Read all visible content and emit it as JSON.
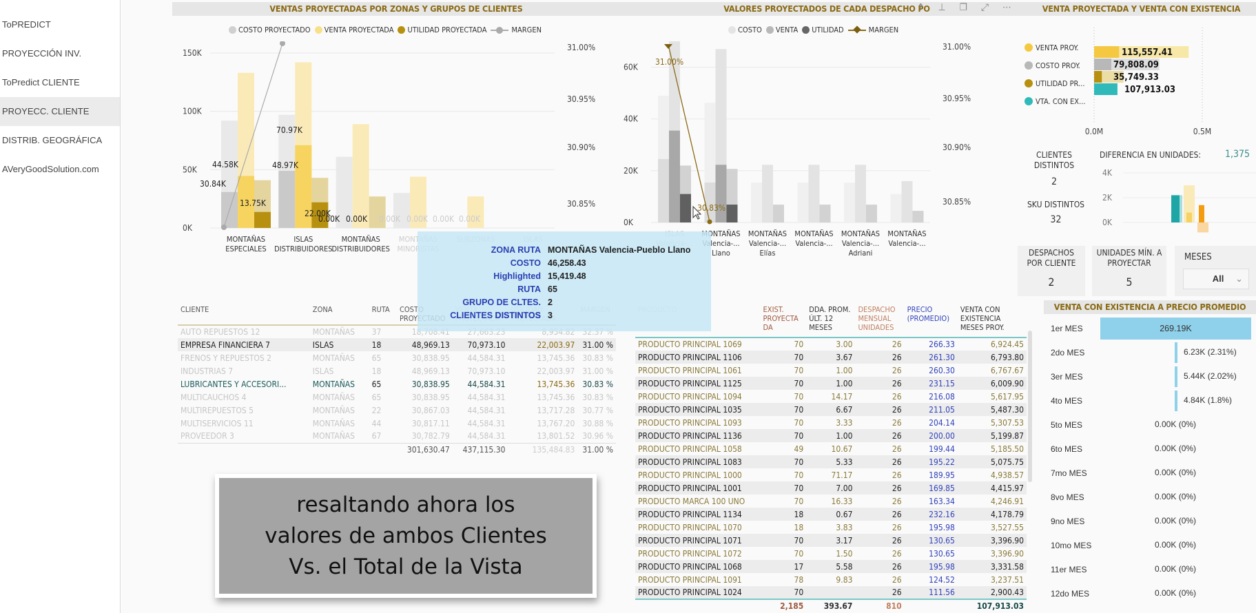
{
  "sidebar": {
    "items": [
      {
        "label": "ToPREDICT",
        "active": false
      },
      {
        "label": "PROYECCIÓN INV.",
        "active": false
      },
      {
        "label": "ToPredict CLIENTE",
        "active": false
      },
      {
        "label": "PROYECC. CLIENTE",
        "active": true
      },
      {
        "label": "DISTRIB. GEOGRÁFICA",
        "active": false
      },
      {
        "label": "AVeryGoodSolution.com",
        "active": false
      }
    ]
  },
  "chart1": {
    "title": "VENTAS PROYECTADAS POR ZONAS Y GRUPOS DE CLIENTES",
    "legend": [
      "COSTO PROYECTADO",
      "VENTA PROYECTADA",
      "UTILIDAD PROYECTADA",
      "MARGEN"
    ],
    "y_ticks": [
      "150K",
      "100K",
      "50K",
      "0K"
    ],
    "y2_ticks": [
      "31.00%",
      "30.95%",
      "30.90%",
      "30.85%"
    ],
    "categories": [
      "MONTAÑAS|ESPECIALES",
      "ISLAS|DISTRIBUIDORES",
      "MONTAÑAS|DISTRIBUIDORES",
      "MONTAÑAS|MINORISTAS",
      "SUBZONAS",
      "ISLAS"
    ],
    "data_labels": [
      "30.84K",
      "44.58K",
      "13.75K",
      "48.97K",
      "70.97K",
      "22.00K",
      "0.00K",
      "0.00K",
      "0.00K",
      "0.00K",
      "0.00K",
      "0.00K"
    ]
  },
  "chart2": {
    "title": "VALORES PROYECTADOS DE CADA DESPACHO PO",
    "legend": [
      "COSTO",
      "VENTA",
      "UTILIDAD",
      "MARGEN"
    ],
    "y_ticks": [
      "60K",
      "40K",
      "20K",
      "0K"
    ],
    "y2_ticks": [
      "31.00%",
      "30.95%",
      "30.90%",
      "30.85%"
    ],
    "categories": [
      "ISLAS|Valencia-...",
      "MONTAÑAS|Valencia-...|Llano",
      "MONTAÑAS|Valencia-...|Elías",
      "MONTAÑAS|Valencia-...",
      "MONTAÑAS|Valencia-...|Adriani",
      "MONTAÑAS|Valencia-..."
    ],
    "margin_labels": [
      "31.00%",
      "30.83%"
    ]
  },
  "chart_data": [
    {
      "type": "bar",
      "title": "VENTAS PROYECTADAS POR ZONAS Y GRUPOS DE CLIENTES",
      "categories": [
        "MONTAÑAS ESPECIALES",
        "ISLAS DISTRIBUIDORES",
        "MONTAÑAS DISTRIBUIDORES",
        "MONTAÑAS MINORISTAS",
        "SUBZONAS",
        "ISLAS"
      ],
      "series": [
        {
          "name": "COSTO PROYECTADO",
          "values": [
            92000,
            97000,
            61000,
            30000,
            0,
            0
          ],
          "highlighted": [
            30840,
            48970,
            0,
            0,
            0,
            0
          ]
        },
        {
          "name": "VENTA PROYECTADA",
          "values": [
            133000,
            142000,
            89000,
            44000,
            27000,
            0
          ],
          "highlighted": [
            44580,
            70970,
            0,
            0,
            0,
            0
          ]
        },
        {
          "name": "UTILIDAD PROYECTADA",
          "values": [
            41000,
            43000,
            27000,
            0,
            0,
            0
          ],
          "highlighted": [
            13750,
            22000,
            0,
            0,
            0,
            0
          ]
        },
        {
          "name": "MARGEN",
          "values": [
            30.83,
            31.0
          ],
          "axis": "right"
        }
      ],
      "ylim": [
        0,
        160000
      ],
      "y2lim": [
        30.82,
        31.01
      ]
    },
    {
      "type": "bar",
      "title": "VALORES PROYECTADOS DE CADA DESPACHO PO",
      "categories": [
        "ISLAS Valencia-...",
        "MONTAÑAS Valencia-... Llano",
        "MONTAÑAS Valencia-... Elías",
        "MONTAÑAS Valencia-...",
        "MONTAÑAS Valencia-... Adriani",
        "MONTAÑAS Valencia-..."
      ],
      "series": [
        {
          "name": "COSTO",
          "values": [
            49000,
            46258,
            15400,
            15400,
            15400,
            11000
          ],
          "highlighted": [
            24500,
            15419,
            0,
            0,
            0,
            0
          ]
        },
        {
          "name": "VENTA",
          "values": [
            71000,
            67000,
            22300,
            22300,
            22300,
            16000
          ],
          "highlighted": [
            35500,
            22300,
            0,
            0,
            0,
            0
          ]
        },
        {
          "name": "UTILIDAD",
          "values": [
            22000,
            20700,
            6900,
            6900,
            6900,
            4500
          ],
          "highlighted": [
            11000,
            6900,
            0,
            0,
            0,
            0
          ]
        },
        {
          "name": "MARGEN",
          "values": [
            31.0,
            30.83
          ],
          "axis": "right"
        }
      ],
      "ylim": [
        0,
        70000
      ],
      "y2lim": [
        30.82,
        31.01
      ]
    },
    {
      "type": "bar",
      "title": "VENTA PROYECTADA Y VENTA CON EXISTENCIA",
      "categories": [
        "VENTA PROY.",
        "COSTO PROY.",
        "UTILIDAD PR...",
        "VTA. CON EX..."
      ],
      "values": [
        115557.41,
        79808.09,
        35749.33,
        107913.03
      ],
      "totals": [
        437115.3,
        301630.47,
        135484.83,
        107913.03
      ],
      "xlim": [
        0,
        0.5
      ],
      "xticks": [
        "0.0M",
        "0.5M"
      ]
    },
    {
      "type": "bar",
      "title": "DIFERENCIA EN UNIDADES",
      "yticks": [
        "4K",
        "2K",
        "0K"
      ],
      "values": [
        2200,
        3000,
        800,
        1400,
        -800
      ]
    },
    {
      "type": "bar",
      "title": "VENTA CON EXISTENCIA A PRECIO PROMEDIO",
      "categories": [
        "1er MES",
        "2do MES",
        "3er MES",
        "4to MES",
        "5to MES",
        "6to MES",
        "7mo MES",
        "8vo MES",
        "9no MES",
        "10mo MES",
        "11er MES",
        "12do MES"
      ],
      "values": [
        269.19,
        6.23,
        5.44,
        4.84,
        0,
        0,
        0,
        0,
        0,
        0,
        0,
        0
      ],
      "labels": [
        "269.19K",
        "6.23K (2.31%)",
        "5.44K (2.02%)",
        "4.84K (1.8%)",
        "0.00K (0%)",
        "0.00K (0%)",
        "0.00K (0%)",
        "0.00K (0%)",
        "0.00K (0%)",
        "0.00K (0%)",
        "0.00K (0%)",
        "0.00K (0%)"
      ]
    }
  ],
  "tooltip": {
    "rows": [
      {
        "k": "ZONA RUTA",
        "v": "MONTAÑAS Valencia-Pueblo Llano"
      },
      {
        "k": "COSTO",
        "v": "46,258.43"
      },
      {
        "k": "Highlighted",
        "v": "15,419.48"
      },
      {
        "k": "RUTA",
        "v": "65"
      },
      {
        "k": "GRUPO DE CLTES. DISTINTOS",
        "v": "2"
      },
      {
        "k": "CLIENTES DISTINTOS",
        "v": "3"
      }
    ]
  },
  "clients_table": {
    "headers": [
      "CLIENTE",
      "ZONA",
      "RUTA",
      "COSTO PROYECTADO",
      "VENTA PROYECTADA",
      "UTILIDAD PROYECTADA",
      "MARGEN"
    ],
    "rows": [
      {
        "c": [
          "AUTO REPUESTOS 12",
          "MONTAÑAS",
          "37",
          "18,708.41",
          "27,663.23",
          "8,954.82",
          "32.37 %"
        ],
        "hl": false
      },
      {
        "c": [
          "EMPRESA FINANCIERA 7",
          "ISLAS",
          "18",
          "48,969.13",
          "70,973.10",
          "22,003.97",
          "31.00 %"
        ],
        "hl": true
      },
      {
        "c": [
          "FRENOS Y REPUESTOS 2",
          "MONTAÑAS",
          "65",
          "30,838.95",
          "44,584.31",
          "13,745.36",
          "30.83 %"
        ],
        "hl": false
      },
      {
        "c": [
          "INDUSTRIAS 7",
          "ISLAS",
          "18",
          "48,969.13",
          "70,973.10",
          "22,003.97",
          "31.00 %"
        ],
        "hl": false
      },
      {
        "c": [
          "LUBRICANTES Y ACCESORI...",
          "MONTAÑAS",
          "65",
          "30,838.95",
          "44,584.31",
          "13,745.36",
          "30.83 %"
        ],
        "hl": true
      },
      {
        "c": [
          "MULTICAUCHOS 4",
          "MONTAÑAS",
          "65",
          "30,838.95",
          "44,584.31",
          "13,745.36",
          "30.83 %"
        ],
        "hl": false
      },
      {
        "c": [
          "MULTIREPUESTOS 5",
          "MONTAÑAS",
          "22",
          "30,867.03",
          "44,584.31",
          "13,717.28",
          "30.77 %"
        ],
        "hl": false
      },
      {
        "c": [
          "MULTISERVICIOS 11",
          "MONTAÑAS",
          "44",
          "30,817.11",
          "44,584.31",
          "13,767.20",
          "30.88 %"
        ],
        "hl": false
      },
      {
        "c": [
          "PROVEEDOR 3",
          "MONTAÑAS",
          "67",
          "30,782.79",
          "44,584.31",
          "13,801.52",
          "30.96 %"
        ],
        "hl": false
      }
    ],
    "totals": [
      "",
      "",
      "",
      "301,630.47",
      "437,115.30",
      "135,484.83",
      "31.00 %"
    ]
  },
  "products_table": {
    "headers": [
      "PRODUCTO",
      "EXIST. PROYECTA DA",
      "DDA. PROM. ÚLT. 12 MESES",
      "DESPACHO MENSUAL UNIDADES",
      "PRECIO (PROMEDIO)",
      "VENTA CON EXISTENCIA MESES PROY."
    ],
    "rows": [
      [
        "PRODUCTO PRINCIPAL 1069",
        "70",
        "3.00",
        "26",
        "266.33",
        "6,924.45"
      ],
      [
        "PRODUCTO PRINCIPAL 1106",
        "70",
        "3.67",
        "26",
        "261.30",
        "6,793.80"
      ],
      [
        "PRODUCTO PRINCIPAL 1061",
        "70",
        "1.00",
        "26",
        "260.30",
        "6,767.67"
      ],
      [
        "PRODUCTO PRINCIPAL 1125",
        "70",
        "1.00",
        "26",
        "231.15",
        "6,009.90"
      ],
      [
        "PRODUCTO PRINCIPAL 1094",
        "70",
        "14.17",
        "26",
        "216.08",
        "5,617.95"
      ],
      [
        "PRODUCTO PRINCIPAL 1035",
        "70",
        "6.67",
        "26",
        "211.05",
        "5,487.30"
      ],
      [
        "PRODUCTO PRINCIPAL 1093",
        "70",
        "3.33",
        "26",
        "204.14",
        "5,307.53"
      ],
      [
        "PRODUCTO PRINCIPAL 1136",
        "70",
        "1.00",
        "26",
        "200.00",
        "5,199.87"
      ],
      [
        "PRODUCTO PRINCIPAL 1058",
        "49",
        "10.67",
        "26",
        "199.44",
        "5,185.50"
      ],
      [
        "PRODUCTO PRINCIPAL 1083",
        "70",
        "5.33",
        "26",
        "195.22",
        "5,075.75"
      ],
      [
        "PRODUCTO PRINCIPAL 1000",
        "70",
        "71.17",
        "26",
        "189.95",
        "4,938.57"
      ],
      [
        "PRODUCTO PRINCIPAL 1001",
        "70",
        "7.00",
        "26",
        "169.85",
        "4,415.97"
      ],
      [
        "PRODUCTO MARCA 100 UNO",
        "70",
        "16.33",
        "26",
        "163.34",
        "4,246.91"
      ],
      [
        "PRODUCTO PRINCIPAL 1134",
        "18",
        "0.67",
        "26",
        "232.16",
        "4,178.79"
      ],
      [
        "PRODUCTO PRINCIPAL 1070",
        "18",
        "3.83",
        "26",
        "195.98",
        "3,527.55"
      ],
      [
        "PRODUCTO PRINCIPAL 1071",
        "70",
        "3.17",
        "26",
        "130.65",
        "3,396.90"
      ],
      [
        "PRODUCTO PRINCIPAL 1072",
        "70",
        "1.50",
        "26",
        "130.65",
        "3,396.90"
      ],
      [
        "PRODUCTO PRINCIPAL 1068",
        "17",
        "5.58",
        "26",
        "195.98",
        "3,331.58"
      ],
      [
        "PRODUCTO PRINCIPAL 1091",
        "78",
        "9.83",
        "26",
        "124.52",
        "3,237.51"
      ],
      [
        "PRODUCTO PRINCIPAL 1024",
        "70",
        "",
        "26",
        "111.56",
        "2,900.43"
      ]
    ],
    "totals": [
      "",
      "2,185",
      "393.67",
      "810",
      "",
      "107,913.03"
    ]
  },
  "kpis": {
    "clientes_label": "CLIENTES DISTINTOS",
    "clientes_value": "2",
    "sku_label": "SKU DISTINTOS",
    "sku_value": "32",
    "diff_label": "DIFERENCIA EN UNIDADES:",
    "diff_value": "1,375",
    "despachos_label": "DESPACHOS POR CLIENTE",
    "despachos_value": "2",
    "unidades_label": "UNIDADES MÍN. A PROYECTAR",
    "unidades_value": "5",
    "meses_label": "MESES",
    "meses_value": "All"
  },
  "caption": {
    "text": "resaltando ahora los\nvalores de ambos Clientes\nVs. el Total de la Vista"
  },
  "colors": {
    "title": "#8a6a14",
    "costo_light": "#e6e6e6",
    "costo": "#c4c4c4",
    "venta_light": "#f9eab8",
    "venta": "#f5d263",
    "utilidad_light": "#e3d29a",
    "utilidad": "#b8900f",
    "teal": "#30b9b9",
    "month_bar": "#8fd1ea",
    "blue_text": "#3344bb"
  }
}
